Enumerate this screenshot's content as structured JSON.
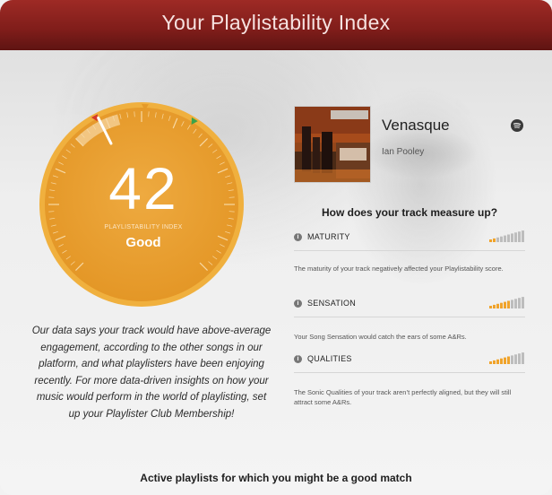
{
  "header": {
    "title": "Your Playlistability Index"
  },
  "gauge": {
    "score": "42",
    "score_fraction": 0.42,
    "label": "PLAYLISTABILITY INDEX",
    "grade": "Good",
    "colors": {
      "fill": "#e9a23a",
      "ring": "#f0b03e",
      "marker_low": "#d63a2a",
      "marker_mid": "#e59a2a",
      "marker_high": "#3aa34a"
    }
  },
  "description": "Our data says your track would have above-average engagement, according to the other songs in our platform, and what playlisters have been enjoying recently. For more data-driven insights on how your music would perform in the world of playlisting, set up your Playlister Club Membership!",
  "track": {
    "title": "Venasque",
    "artist": "Ian Pooley",
    "service_icon": "spotify-icon"
  },
  "measure": {
    "heading": "How does your track measure up?",
    "metrics": [
      {
        "label": "MATURITY",
        "level": 0.2,
        "note": "The maturity of your track negatively affected your Playlistability score."
      },
      {
        "label": "SENSATION",
        "level": 0.6,
        "note": "Your Song Sensation would catch the ears of some A&Rs."
      },
      {
        "label": "QUALITIES",
        "level": 0.6,
        "note": "The Sonic Qualities of your track aren’t perfectly aligned, but they will still attract some A&Rs."
      }
    ],
    "colors": {
      "active": "#f0a32a",
      "inactive": "#bdbdbd"
    }
  },
  "footer": {
    "heading": "Active playlists for which you might be a good match"
  }
}
